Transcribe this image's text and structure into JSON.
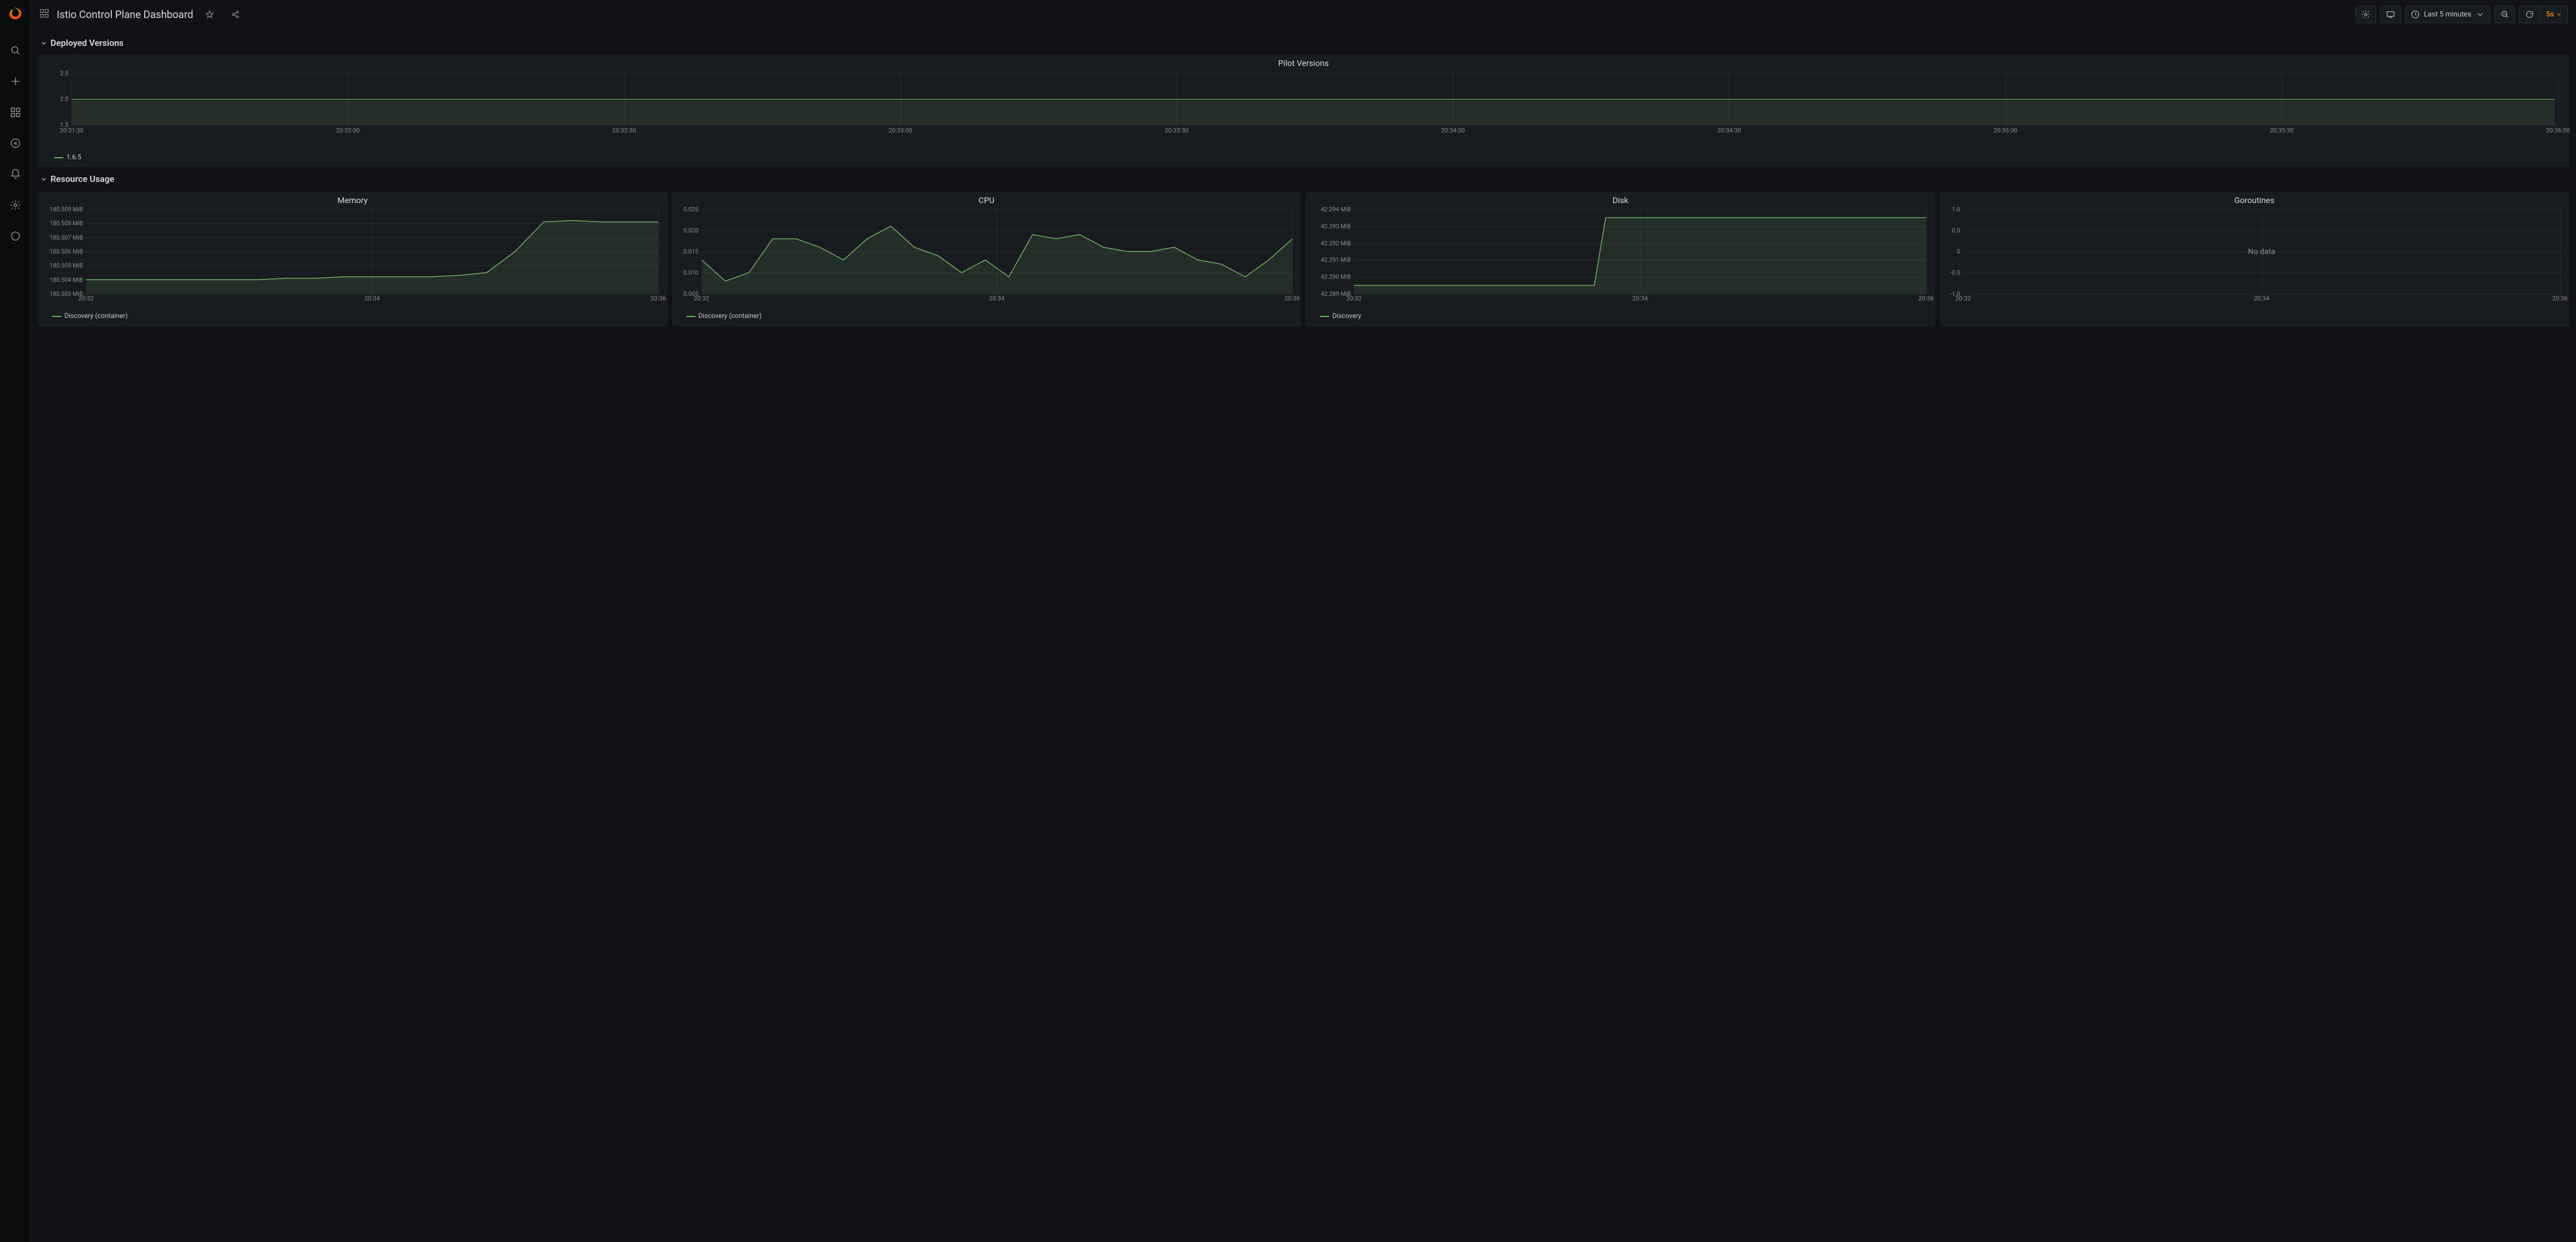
{
  "header": {
    "title": "Istio Control Plane Dashboard",
    "time_range_label": "Last 5 minutes",
    "refresh_rate": "5s"
  },
  "rows": {
    "deployed_versions_label": "Deployed Versions",
    "resource_usage_label": "Resource Usage"
  },
  "legend": {
    "pilot": "1.6.5",
    "memory": "Discovery (container)",
    "cpu": "Discovery (container)",
    "disk": "Discovery",
    "goroutines_nodata": "No data"
  },
  "panels": {
    "pilot_title": "Pilot Versions",
    "memory_title": "Memory",
    "cpu_title": "CPU",
    "disk_title": "Disk",
    "goroutines_title": "Goroutines"
  },
  "x_small": [
    "20:32",
    "20:34",
    "20:36"
  ],
  "chart_data": [
    {
      "id": "pilot_versions",
      "type": "line",
      "title": "Pilot Versions",
      "x": [
        "20:31:30",
        "20:32:00",
        "20:32:30",
        "20:33:00",
        "20:33:30",
        "20:34:00",
        "20:34:30",
        "20:35:00",
        "20:35:30",
        "20:36:00"
      ],
      "series": [
        {
          "name": "1.6.5",
          "values": [
            2.0,
            2.0,
            2.0,
            2.0,
            2.0,
            2.0,
            2.0,
            2.0,
            2.0,
            2.0
          ]
        }
      ],
      "yticks": [
        1.5,
        2.0,
        2.5
      ],
      "ytick_labels": [
        "1.5",
        "2.0",
        "2.5"
      ],
      "ylim": [
        1.5,
        2.5
      ]
    },
    {
      "id": "memory",
      "type": "line",
      "title": "Memory",
      "x": [
        "20:32",
        "20:34",
        "20:36"
      ],
      "series": [
        {
          "name": "Discovery (container)",
          "x_rel": [
            0,
            5,
            10,
            15,
            20,
            25,
            30,
            35,
            40,
            45,
            50,
            55,
            60,
            65,
            70,
            75,
            80,
            85,
            90,
            95,
            100
          ],
          "values_mib": [
            180.504,
            180.504,
            180.504,
            180.504,
            180.504,
            180.504,
            180.504,
            180.5041,
            180.5041,
            180.5042,
            180.5042,
            180.5042,
            180.5042,
            180.5043,
            180.5045,
            180.506,
            180.5081,
            180.5082,
            180.5081,
            180.5081,
            180.5081
          ]
        }
      ],
      "yticks_mib": [
        180.503,
        180.504,
        180.505,
        180.506,
        180.507,
        180.508,
        180.509
      ],
      "ytick_labels": [
        "180.503 MiB",
        "180.504 MiB",
        "180.505 MiB",
        "180.506 MiB",
        "180.507 MiB",
        "180.508 MiB",
        "180.509 MiB"
      ],
      "ylim_mib": [
        180.503,
        180.509
      ],
      "ylabel": "MiB"
    },
    {
      "id": "cpu",
      "type": "line",
      "title": "CPU",
      "x": [
        "20:32",
        "20:34",
        "20:36"
      ],
      "series": [
        {
          "name": "Discovery (container)",
          "x_rel": [
            0,
            4,
            8,
            12,
            16,
            20,
            24,
            28,
            32,
            36,
            40,
            44,
            48,
            52,
            56,
            60,
            64,
            68,
            72,
            76,
            80,
            84,
            88,
            92,
            96,
            100
          ],
          "values": [
            0.013,
            0.008,
            0.01,
            0.018,
            0.018,
            0.016,
            0.013,
            0.018,
            0.021,
            0.016,
            0.014,
            0.01,
            0.013,
            0.009,
            0.019,
            0.018,
            0.019,
            0.016,
            0.015,
            0.015,
            0.016,
            0.013,
            0.012,
            0.009,
            0.013,
            0.018
          ]
        }
      ],
      "yticks": [
        0.005,
        0.01,
        0.015,
        0.02,
        0.025
      ],
      "ytick_labels": [
        "0.005",
        "0.010",
        "0.015",
        "0.020",
        "0.025"
      ],
      "ylim": [
        0.005,
        0.025
      ]
    },
    {
      "id": "disk",
      "type": "line",
      "title": "Disk",
      "x": [
        "20:32",
        "20:34",
        "20:36"
      ],
      "series": [
        {
          "name": "Discovery",
          "x_rel": [
            0,
            10,
            20,
            30,
            36,
            42,
            44,
            46,
            100
          ],
          "values_mib": [
            42.2895,
            42.2895,
            42.2895,
            42.2895,
            42.2895,
            42.2895,
            42.2935,
            42.2935,
            42.2935
          ]
        }
      ],
      "yticks_mib": [
        42.289,
        42.29,
        42.291,
        42.292,
        42.293,
        42.294
      ],
      "ytick_labels": [
        "42.289 MiB",
        "42.290 MiB",
        "42.291 MiB",
        "42.292 MiB",
        "42.293 MiB",
        "42.294 MiB"
      ],
      "ylim_mib": [
        42.289,
        42.294
      ],
      "ylabel": "MiB"
    },
    {
      "id": "goroutines",
      "type": "line",
      "title": "Goroutines",
      "x": [
        "20:32",
        "20:34",
        "20:36"
      ],
      "series": [],
      "yticks": [
        -1.0,
        -0.5,
        0,
        0.5,
        1.0
      ],
      "ytick_labels": [
        "-1.0",
        "-0.5",
        "0",
        "0.5",
        "1.0"
      ],
      "ylim": [
        -1.0,
        1.0
      ],
      "no_data_label": "No data"
    }
  ]
}
